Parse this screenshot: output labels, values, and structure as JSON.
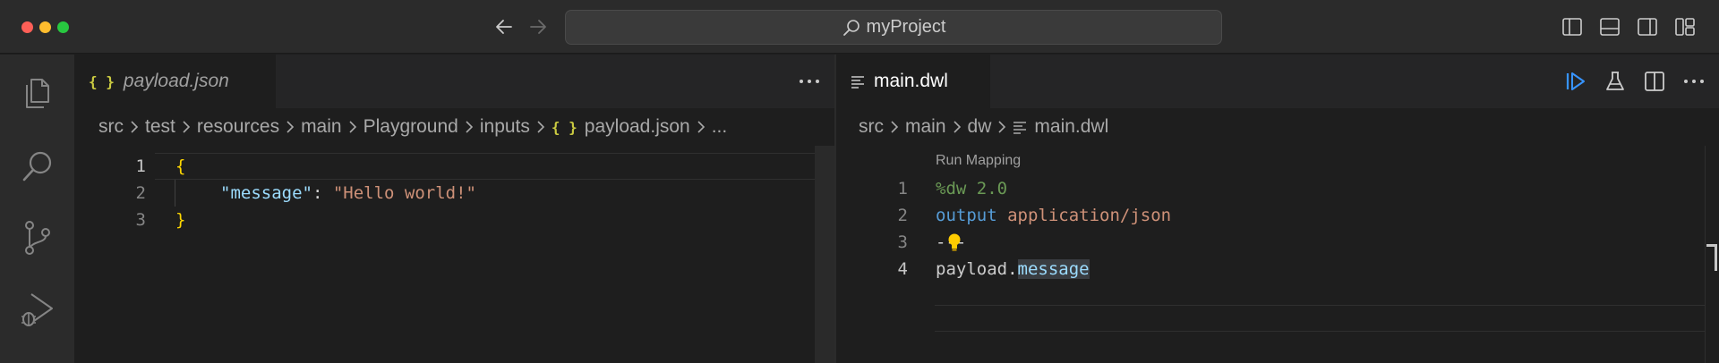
{
  "window": {
    "title": "myProject"
  },
  "left_editor": {
    "tab": {
      "icon": "json-braces-icon",
      "label": "payload.json"
    },
    "breadcrumb": [
      "src",
      "test",
      "resources",
      "main",
      "Playground",
      "inputs",
      "payload.json",
      "..."
    ],
    "breadcrumb_file_icon": "{ }",
    "lines": [
      {
        "number": "1",
        "text": "{"
      },
      {
        "number": "2",
        "key": "\"message\"",
        "sep": ": ",
        "value": "\"Hello world!\""
      },
      {
        "number": "3",
        "text": "}"
      }
    ]
  },
  "right_editor": {
    "tab": {
      "icon": "dwl-file-icon",
      "label": "main.dwl"
    },
    "breadcrumb": [
      "src",
      "main",
      "dw",
      "main.dwl"
    ],
    "codelens": "Run Mapping",
    "lines": [
      {
        "number": "1",
        "text": "%dw 2.0"
      },
      {
        "number": "2",
        "keyword": "output",
        "mime": "application/json"
      },
      {
        "number": "3",
        "text": "---"
      },
      {
        "number": "4",
        "obj": "payload",
        "dot": ".",
        "prop": "message"
      }
    ]
  },
  "icons": {
    "activity": [
      "files-icon",
      "search-icon",
      "source-control-icon",
      "run-debug-icon"
    ],
    "layout": [
      "toggle-primary-sidebar-icon",
      "toggle-panel-icon",
      "toggle-secondary-sidebar-icon",
      "customize-layout-icon"
    ],
    "right_actions": [
      "run-mapping-icon",
      "test-flask-icon",
      "split-editor-icon",
      "more-actions-icon"
    ]
  },
  "colors": {
    "accent_blue": "#3794ff",
    "lightbulb": "#ffcc00",
    "json_braces": "#cbcb41"
  }
}
